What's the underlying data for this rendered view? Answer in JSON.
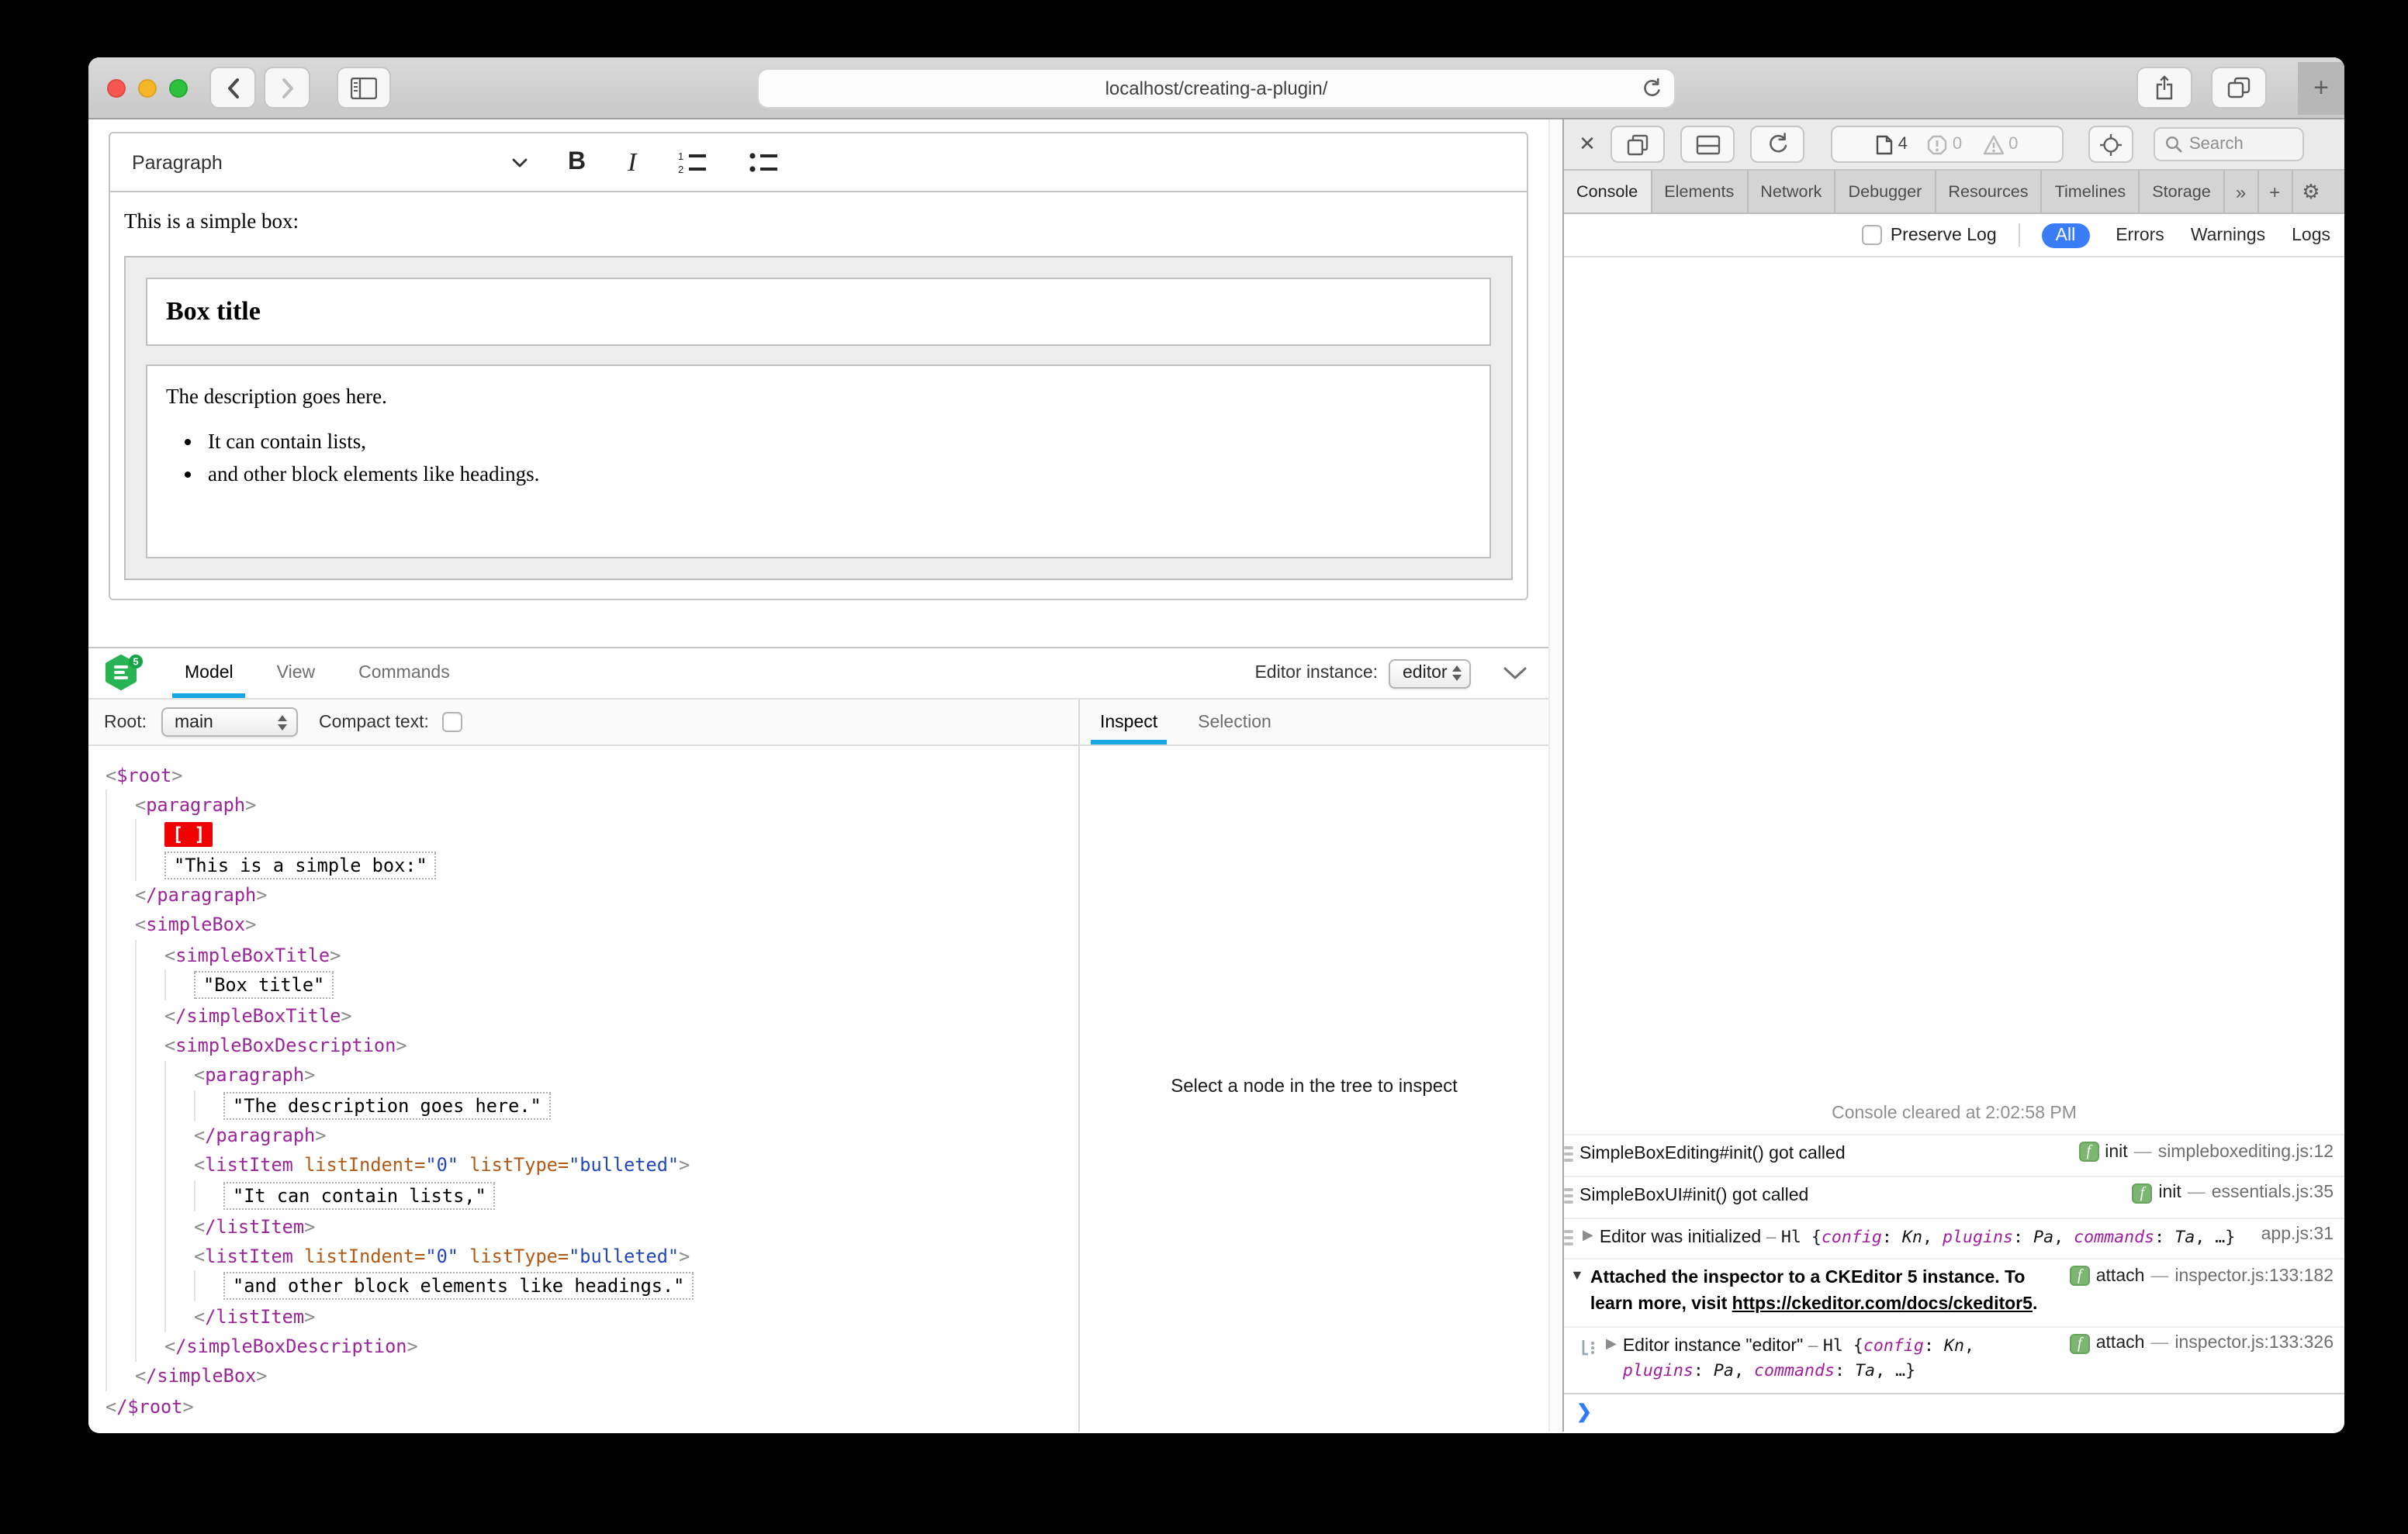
{
  "colors": {
    "inspector_accent": "#18a7e5",
    "filter_active_blue": "#3b7df7",
    "selection_red": "#f00000",
    "badge_green": "#7cb672",
    "logo_green": "#28b454",
    "tag_purple": "#9b249b",
    "attr_name_orange": "#b35914",
    "attr_value_blue": "#2145be",
    "object_key_purple": "#a21c9e"
  },
  "browser": {
    "url": "localhost/creating-a-plugin/",
    "new_tab": "+"
  },
  "editor": {
    "toolbar": {
      "heading": "Paragraph",
      "bold": "B",
      "italic": "I"
    },
    "content": {
      "intro": "This is a simple box:",
      "box_title": "Box title",
      "description": "The description goes here.",
      "list": [
        "It can contain lists,",
        "and other block elements like headings."
      ]
    }
  },
  "inspector": {
    "logo_badge": "5",
    "tabs": [
      {
        "label": "Model",
        "active": true
      },
      {
        "label": "View",
        "active": false
      },
      {
        "label": "Commands",
        "active": false
      }
    ],
    "instance_label": "Editor instance:",
    "instance_value": "editor",
    "root_label": "Root:",
    "root_value": "main",
    "compact_label": "Compact text:",
    "pane_tabs": [
      {
        "label": "Inspect",
        "active": true
      },
      {
        "label": "Selection",
        "active": false
      }
    ],
    "inspect_placeholder": "Select a node in the tree to inspect",
    "tree": {
      "lines": [
        {
          "i": 0,
          "k": "open",
          "n": "$root"
        },
        {
          "i": 1,
          "k": "open",
          "n": "paragraph"
        },
        {
          "i": 2,
          "k": "sel",
          "t": "[ ]"
        },
        {
          "i": 2,
          "k": "text",
          "t": "\"This is a simple box:\""
        },
        {
          "i": 1,
          "k": "close",
          "n": "paragraph"
        },
        {
          "i": 1,
          "k": "open",
          "n": "simpleBox"
        },
        {
          "i": 2,
          "k": "open",
          "n": "simpleBoxTitle"
        },
        {
          "i": 3,
          "k": "text",
          "t": "\"Box title\""
        },
        {
          "i": 2,
          "k": "close",
          "n": "simpleBoxTitle"
        },
        {
          "i": 2,
          "k": "open",
          "n": "simpleBoxDescription"
        },
        {
          "i": 3,
          "k": "open",
          "n": "paragraph"
        },
        {
          "i": 4,
          "k": "text",
          "t": "\"The description goes here.\""
        },
        {
          "i": 3,
          "k": "close",
          "n": "paragraph"
        },
        {
          "i": 3,
          "k": "open",
          "n": "listItem",
          "attrs": [
            [
              "listIndent",
              "0"
            ],
            [
              "listType",
              "bulleted"
            ]
          ]
        },
        {
          "i": 4,
          "k": "text",
          "t": "\"It can contain lists,\""
        },
        {
          "i": 3,
          "k": "close",
          "n": "listItem"
        },
        {
          "i": 3,
          "k": "open",
          "n": "listItem",
          "attrs": [
            [
              "listIndent",
              "0"
            ],
            [
              "listType",
              "bulleted"
            ]
          ]
        },
        {
          "i": 4,
          "k": "text",
          "t": "\"and other block elements like headings.\""
        },
        {
          "i": 3,
          "k": "close",
          "n": "listItem"
        },
        {
          "i": 2,
          "k": "close",
          "n": "simpleBoxDescription"
        },
        {
          "i": 1,
          "k": "close",
          "n": "simpleBox"
        },
        {
          "i": 0,
          "k": "close",
          "n": "$root"
        }
      ]
    }
  },
  "devtools": {
    "toolbar": {
      "close": "✕",
      "page_count": "4",
      "error_count": "0",
      "warning_count": "0",
      "search": "Search"
    },
    "tabs": [
      {
        "label": "Console",
        "active": true
      },
      {
        "label": "Elements",
        "active": false
      },
      {
        "label": "Network",
        "active": false
      },
      {
        "label": "Debugger",
        "active": false
      },
      {
        "label": "Resources",
        "active": false
      },
      {
        "label": "Timelines",
        "active": false
      },
      {
        "label": "Storage",
        "active": false
      }
    ],
    "tabs_overflow": "»",
    "tabs_add": "+",
    "gear": "⚙",
    "filter": {
      "preserve_label": "Preserve Log",
      "scopes": [
        {
          "label": "All",
          "active": true
        },
        {
          "label": "Errors",
          "active": false
        },
        {
          "label": "Warnings",
          "active": false
        },
        {
          "label": "Logs",
          "active": false
        }
      ]
    },
    "console": {
      "cleared": "Console cleared at 2:02:58 PM",
      "rows": [
        {
          "icon": "bars",
          "text": "SimpleBoxEditing#init() got called",
          "fn": "init",
          "file": "simpleboxediting.js:12"
        },
        {
          "icon": "bars",
          "text": "SimpleBoxUI#init() got called",
          "fn": "init",
          "file": "essentials.js:35"
        },
        {
          "icon": "bars",
          "arrow": "▶",
          "text": "Editor was initialized",
          "object": {
            "dash": "–",
            "cls": "Hl",
            "pairs": [
              [
                "config",
                "Kn"
              ],
              [
                "plugins",
                "Pa"
              ],
              [
                "commands",
                "Ta"
              ]
            ],
            "ellipsis": "…"
          },
          "file": "app.js:31"
        },
        {
          "arrow": "▼",
          "bold": true,
          "text": "Attached the inspector to a CKEditor 5 instance. To learn more, visit ",
          "link": "https://ckeditor.com/docs/ckeditor5",
          "suffix": ".",
          "fn": "attach",
          "file": "inspector.js:133:182"
        },
        {
          "icon": "log",
          "indent": true,
          "arrow": "▶",
          "text": "Editor instance \"editor\" ",
          "object": {
            "dash": "–",
            "cls": "Hl",
            "pairs": [
              [
                "config",
                "Kn"
              ],
              [
                "plugins",
                "Pa"
              ],
              [
                "commands",
                "Ta"
              ]
            ],
            "ellipsis": "…"
          },
          "fn": "attach",
          "file": "inspector.js:133:326"
        }
      ],
      "prompt": "❯"
    }
  }
}
